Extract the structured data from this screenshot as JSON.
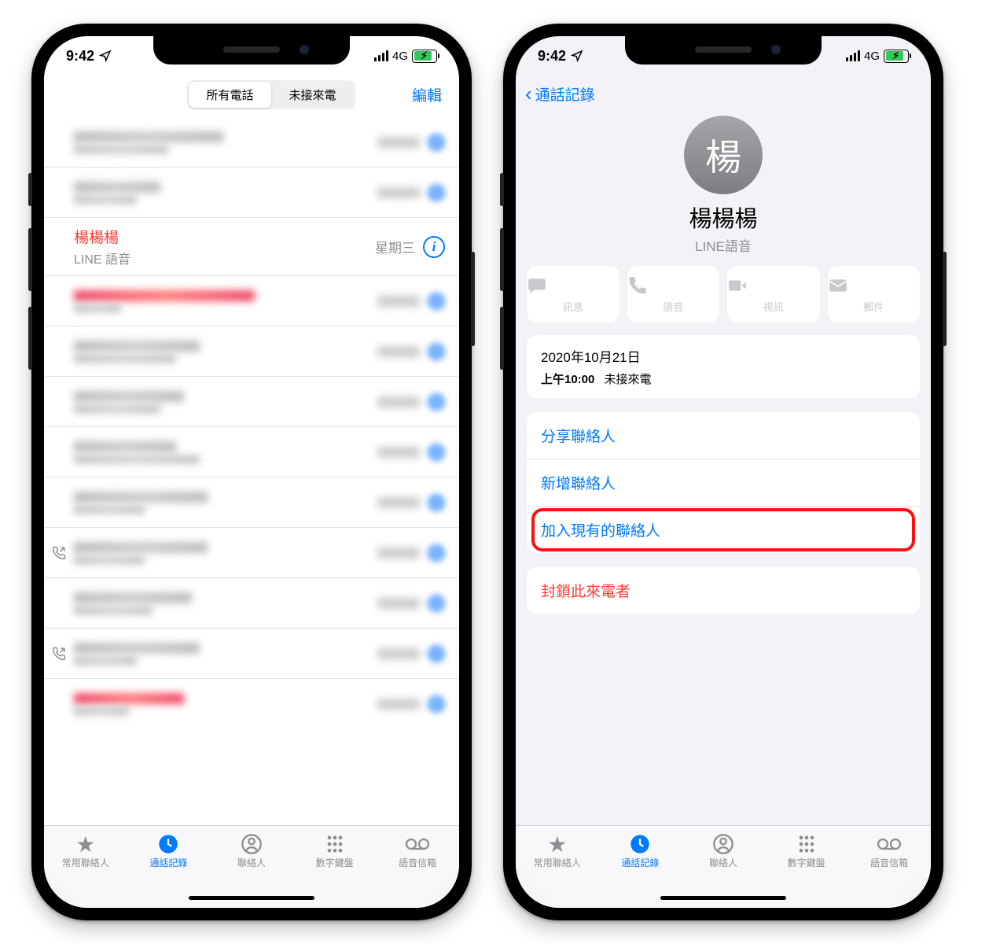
{
  "status": {
    "time": "9:42",
    "network": "4G"
  },
  "left": {
    "seg_all": "所有電話",
    "seg_missed": "未接來電",
    "edit": "編輯",
    "row_name": "楊楊楊",
    "row_sub": "LINE 語音",
    "row_date": "星期三"
  },
  "right": {
    "back": "通話記錄",
    "avatar_initial": "楊",
    "name": "楊楊楊",
    "sub": "LINE語音",
    "actions": {
      "msg": "訊息",
      "voice": "語音",
      "video": "視訊",
      "mail": "郵件"
    },
    "history_date": "2020年10月21日",
    "history_time": "上午10:00",
    "history_label": "未接來電",
    "share": "分享聯絡人",
    "add_new": "新增聯絡人",
    "add_existing": "加入現有的聯絡人",
    "block": "封鎖此來電者"
  },
  "tabs": {
    "fav": "常用聯絡人",
    "recent": "通話記錄",
    "contacts": "聯絡人",
    "keypad": "數字鍵盤",
    "vm": "語音信箱"
  }
}
